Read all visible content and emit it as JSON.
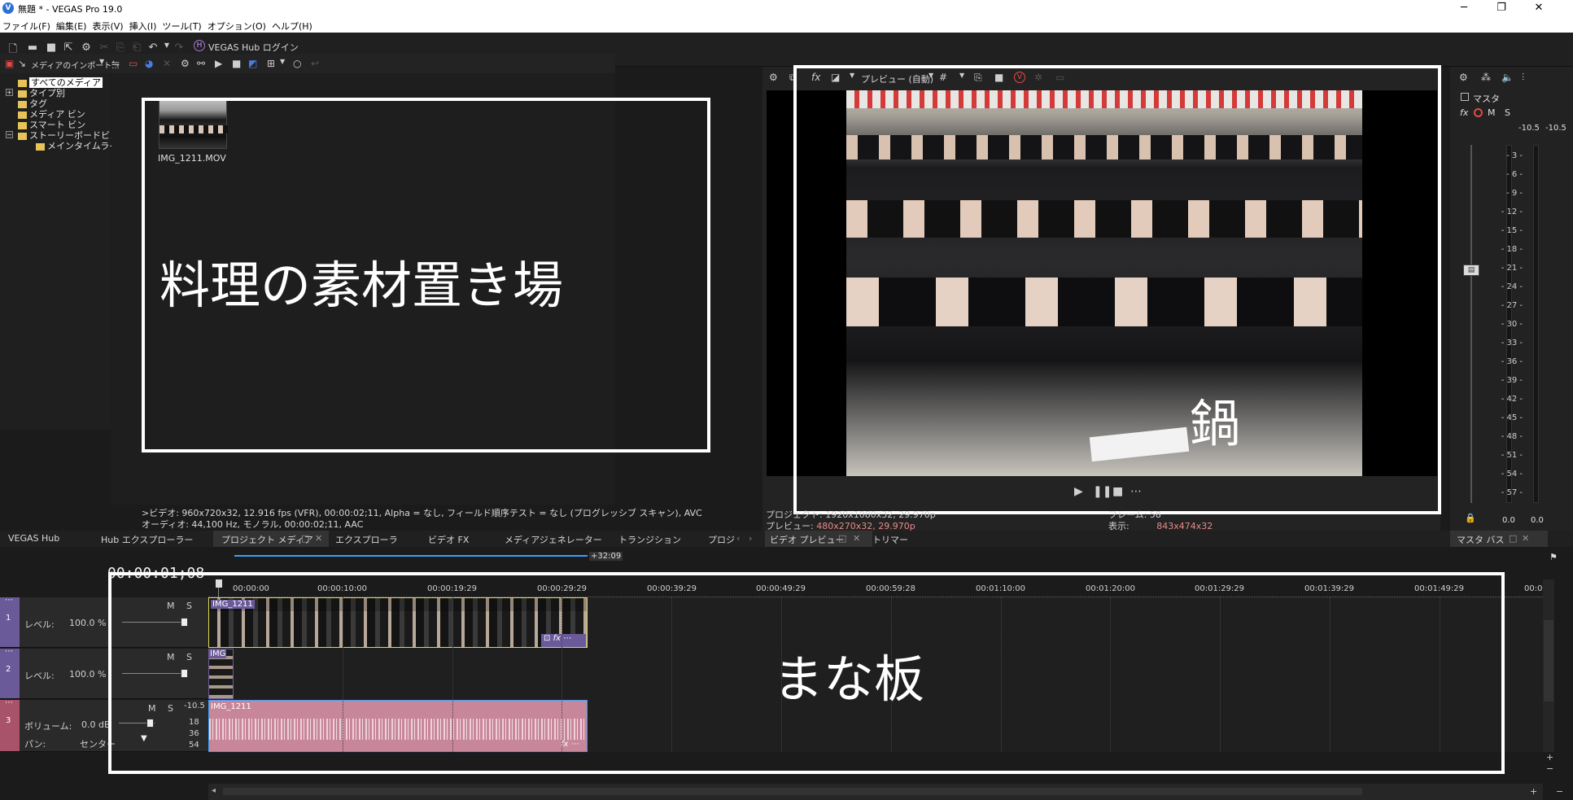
{
  "window": {
    "app_icon_letter": "V",
    "title": "無題 * - VEGAS Pro 19.0",
    "minimize_glyph": "─",
    "maximize_glyph": "❐",
    "close_glyph": "✕"
  },
  "menu": [
    "ファイル(F)",
    "編集(E)",
    "表示(V)",
    "挿入(I)",
    "ツール(T)",
    "オプション(O)",
    "ヘルプ(H)"
  ],
  "toolbar": {
    "hub_login_label": "VEGAS Hub ログイン",
    "hub_badge": "H"
  },
  "media_panel": {
    "import_label": "メディアのインポート...",
    "tree": {
      "all_media": "すべてのメディア",
      "by_type": "タイプ別",
      "tags": "タグ",
      "media_bins": "メディア ビン",
      "smart_bins": "スマート ビン",
      "storyboard_bins": "ストーリーボードビン",
      "main_timeline": "メインタイムライン"
    },
    "file_name": "IMG_1211.MOV",
    "annotation": "料理の素材置き場",
    "info_line1": ">ビデオ: 960x720x32, 12.916 fps (VFR), 00:00:02;11, Alpha = なし, フィールド順序テスト = なし (プログレッシブ スキャン), AVC",
    "info_line2": "オーディオ: 44,100 Hz, モノラル, 00:00:02;11, AAC"
  },
  "preview_panel": {
    "preview_mode": "プレビュー (自動)",
    "annotation": "鍋",
    "project_label": "プロジェクト:",
    "project_value": "1920x1080x32, 29.970p",
    "preview_label": "プレビュー:",
    "preview_value": "480x270x32, 29.970p",
    "frame_label": "フレーム:",
    "frame_value": "58",
    "display_label": "表示:",
    "display_value": "843x474x32"
  },
  "master_panel": {
    "title": "マスタ",
    "m": "M",
    "s": "S",
    "peak_left": "-10.5",
    "peak_right": "-10.5",
    "scale": [
      "3",
      "6",
      "9",
      "12",
      "15",
      "18",
      "21",
      "24",
      "27",
      "30",
      "33",
      "36",
      "39",
      "42",
      "45",
      "48",
      "51",
      "54",
      "57"
    ],
    "bottom_left": "0.0",
    "bottom_right": "0.0"
  },
  "tabs": {
    "left": [
      "VEGAS Hub",
      "Hub エクスプローラー",
      "プロジェクト メディア",
      "エクスプローラ",
      "ビデオ FX",
      "メディアジェネレーター",
      "トランジション",
      "プロジ"
    ],
    "video_preview": "ビデオ プレビュー",
    "trimmer": "トリマー",
    "master_bus": "マスタ バス"
  },
  "timeline": {
    "current_time": "00:00:01;08",
    "loop_end_label": "+32:09",
    "annotation": "まな板",
    "ruler": [
      "00:00:00",
      "00:00:10:00",
      "00:00:19:29",
      "00:00:29:29",
      "00:00:39:29",
      "00:00:49:29",
      "00:00:59:28",
      "00:01:10:00",
      "00:01:20:00",
      "00:01:29:29",
      "00:01:39:29",
      "00:01:49:29",
      "00:0"
    ],
    "tracks": [
      {
        "number": "1",
        "m": "M",
        "s": "S",
        "param_label": "レベル:",
        "param_value": "100.0 %",
        "clip_label": "IMG_1211",
        "color": "#6a5a9a"
      },
      {
        "number": "2",
        "m": "M",
        "s": "S",
        "param_label": "レベル:",
        "param_value": "100.0 %",
        "clip_label": "IMG",
        "color": "#6a5a9a"
      },
      {
        "number": "3",
        "m": "M",
        "s": "S",
        "param_label": "ボリューム:",
        "param_value": "0.0 dB",
        "pan_label": "パン:",
        "pan_value": "センター",
        "clip_label": "IMG_1211",
        "color": "#a8536a",
        "db_top": "-10.5",
        "db_marks": [
          "18",
          "36",
          "54"
        ]
      }
    ],
    "fx_label": "fx"
  }
}
